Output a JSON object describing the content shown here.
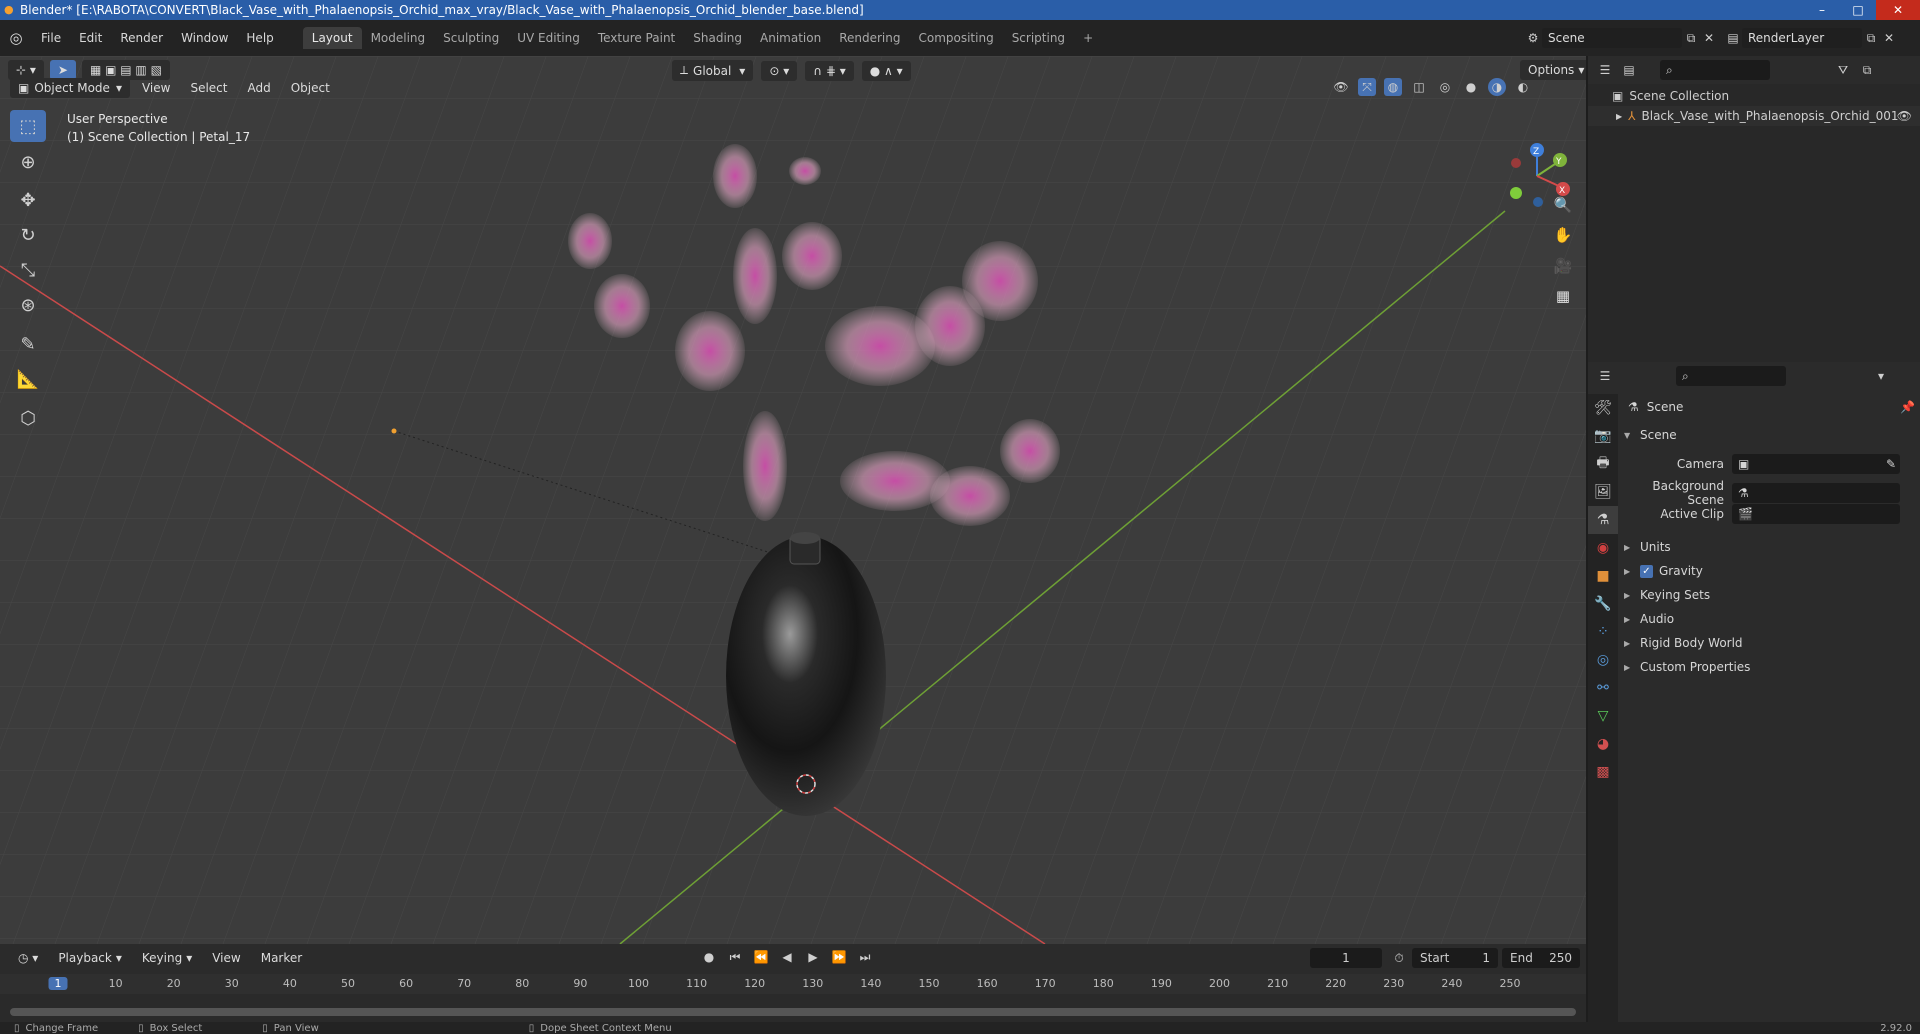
{
  "window": {
    "title": "Blender* [E:\\RABOTA\\CONVERT\\Black_Vase_with_Phalaenopsis_Orchid_max_vray/Black_Vase_with_Phalaenopsis_Orchid_blender_base.blend]",
    "minimize": "–",
    "maximize": "□",
    "close": "✕"
  },
  "menus": [
    "File",
    "Edit",
    "Render",
    "Window",
    "Help"
  ],
  "workspaces": [
    "Layout",
    "Modeling",
    "Sculpting",
    "UV Editing",
    "Texture Paint",
    "Shading",
    "Animation",
    "Rendering",
    "Compositing",
    "Scripting"
  ],
  "workspace_add": "+",
  "scene_selector": {
    "value": "Scene"
  },
  "view_layer_selector": {
    "value": "RenderLayer"
  },
  "viewport": {
    "mode": "Object Mode",
    "header_menus": [
      "View",
      "Select",
      "Add",
      "Object"
    ],
    "transform_orientation": "Global",
    "options_label": "Options",
    "overlay_title": "User Perspective",
    "overlay_subtitle": "(1) Scene Collection | Petal_17",
    "gizmo_axes": {
      "x": "X",
      "y": "Y",
      "z": "Z"
    }
  },
  "outliner": {
    "root": "Scene Collection",
    "items": [
      {
        "label": "Black_Vase_with_Phalaenopsis_Orchid_001"
      }
    ]
  },
  "properties": {
    "context_title": "Scene",
    "section_title": "Scene",
    "fields": [
      {
        "label": "Camera",
        "value": ""
      },
      {
        "label": "Background Scene",
        "value": ""
      },
      {
        "label": "Active Clip",
        "value": ""
      }
    ],
    "panels": [
      {
        "label": "Units",
        "checkbox": false
      },
      {
        "label": "Gravity",
        "checkbox": true
      },
      {
        "label": "Keying Sets",
        "checkbox": false
      },
      {
        "label": "Audio",
        "checkbox": false
      },
      {
        "label": "Rigid Body World",
        "checkbox": false
      },
      {
        "label": "Custom Properties",
        "checkbox": false
      }
    ],
    "gravity_enabled": true
  },
  "timeline": {
    "menus": [
      "Playback",
      "Keying",
      "View",
      "Marker"
    ],
    "current_frame": "1",
    "start_label": "Start",
    "start_value": "1",
    "end_label": "End",
    "end_value": "250",
    "ruler_ticks": [
      "1",
      "10",
      "20",
      "30",
      "40",
      "50",
      "60",
      "70",
      "80",
      "90",
      "100",
      "110",
      "120",
      "130",
      "140",
      "150",
      "160",
      "170",
      "180",
      "190",
      "200",
      "210",
      "220",
      "230",
      "240",
      "250"
    ]
  },
  "statusbar": {
    "items": [
      "Change Frame",
      "Box Select",
      "Pan View",
      "Dope Sheet Context Menu"
    ],
    "version": "2.92.0"
  },
  "colors": {
    "accent": "#4772b3",
    "x_axis": "#d44a4a",
    "y_axis": "#7fb33b",
    "z_axis": "#3f7fdb",
    "petal": "#e79ac0"
  }
}
